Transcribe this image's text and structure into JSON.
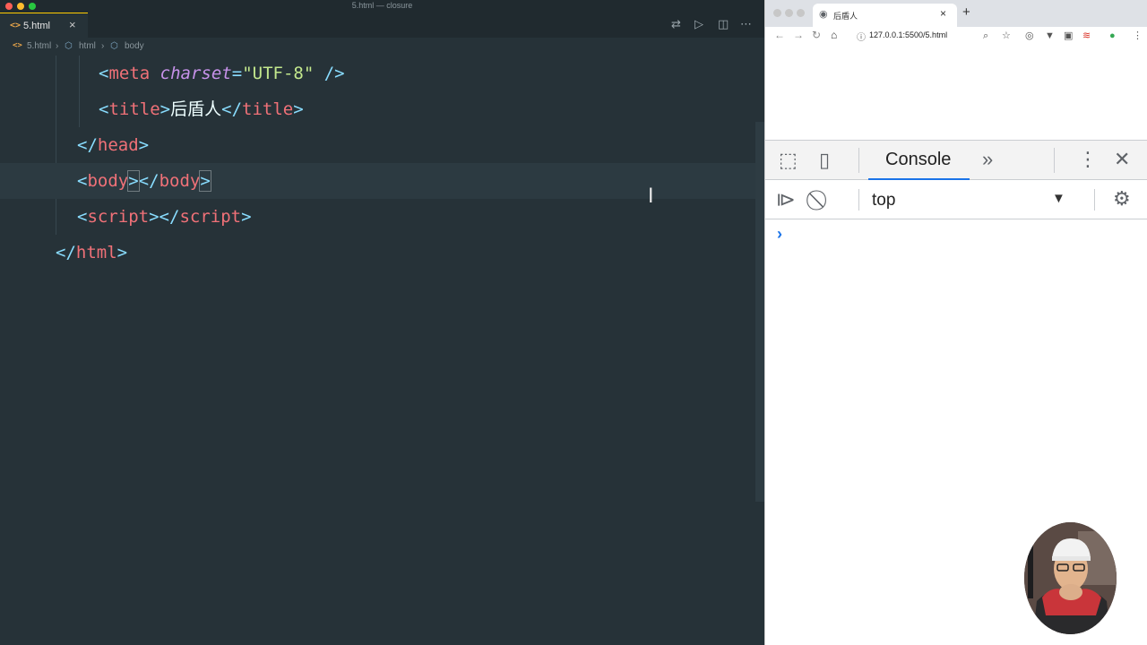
{
  "editor": {
    "window_title": "5.html — closure",
    "tab": {
      "label": "5.html",
      "close_glyph": "×"
    },
    "breadcrumb": [
      "5.html",
      "html",
      "body"
    ],
    "code_lines": [
      {
        "indent": 2,
        "tokens": [
          [
            "b",
            "<"
          ],
          [
            "t",
            "meta"
          ],
          [
            "x",
            " "
          ],
          [
            "a",
            "charset"
          ],
          [
            "b",
            "="
          ],
          [
            "s",
            "\"UTF-8\""
          ],
          [
            "x",
            " "
          ],
          [
            "b",
            "/>"
          ]
        ]
      },
      {
        "indent": 2,
        "tokens": [
          [
            "b",
            "<"
          ],
          [
            "t",
            "title"
          ],
          [
            "b",
            ">"
          ],
          [
            "x",
            "后盾人"
          ],
          [
            "b",
            "</"
          ],
          [
            "t",
            "title"
          ],
          [
            "b",
            ">"
          ]
        ]
      },
      {
        "indent": 1,
        "tokens": [
          [
            "b",
            "</"
          ],
          [
            "t",
            "head"
          ],
          [
            "b",
            ">"
          ]
        ]
      },
      {
        "indent": 1,
        "current": true,
        "tokens": [
          [
            "b",
            "<"
          ],
          [
            "t",
            "body"
          ],
          [
            "b",
            ">"
          ],
          [
            "b",
            "</"
          ],
          [
            "t",
            "body"
          ],
          [
            "b",
            ">"
          ]
        ]
      },
      {
        "indent": 1,
        "tokens": [
          [
            "b",
            "<"
          ],
          [
            "t",
            "script"
          ],
          [
            "b",
            ">"
          ],
          [
            "b",
            "</"
          ],
          [
            "t",
            "script"
          ],
          [
            "b",
            ">"
          ]
        ]
      },
      {
        "indent": 0,
        "tokens": [
          [
            "b",
            "</"
          ],
          [
            "t",
            "html"
          ],
          [
            "b",
            ">"
          ]
        ]
      }
    ],
    "colors": {
      "background": "#263238",
      "tag": "#f07178",
      "bracket": "#89ddff",
      "attribute": "#c792ea",
      "string": "#c3e88d"
    }
  },
  "browser": {
    "tab_title": "后盾人",
    "url": "127.0.0.1:5500/5.html",
    "devtools": {
      "active_panel": "Console",
      "more_glyph": "»",
      "context": "top",
      "prompt_glyph": "›"
    }
  }
}
